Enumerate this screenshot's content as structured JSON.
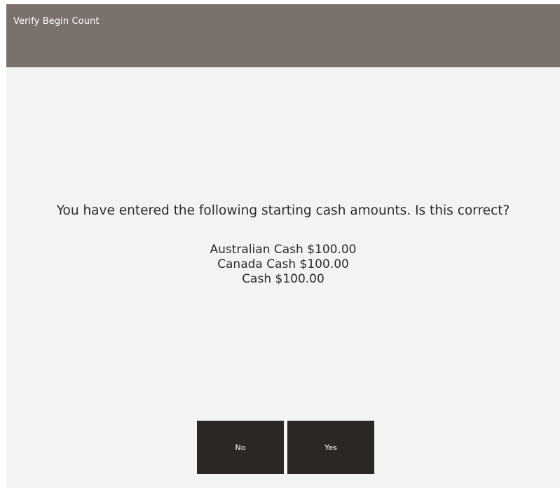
{
  "window": {
    "title": "Verify Begin Count"
  },
  "dialog": {
    "message": "You have entered the following starting cash amounts. Is this correct?",
    "amounts": [
      "Australian Cash $100.00",
      "Canada Cash $100.00",
      "Cash $100.00"
    ]
  },
  "buttons": {
    "no_label": "No",
    "yes_label": "Yes"
  },
  "colors": {
    "titlebar": "#7b716c",
    "background": "#f3f3f2",
    "button": "#2b2724",
    "text": "#2c2c2c"
  }
}
